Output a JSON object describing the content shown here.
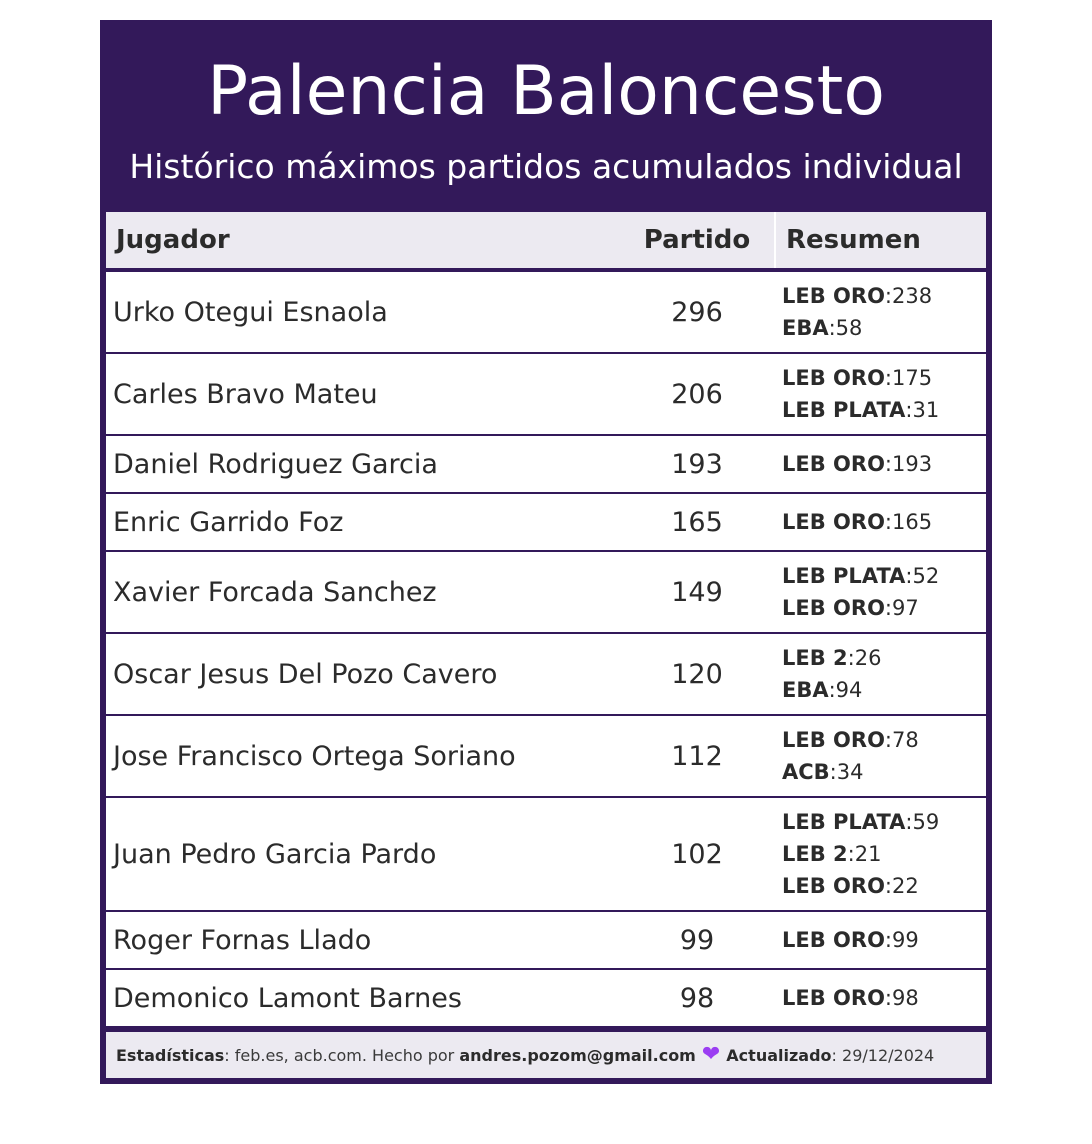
{
  "title": "Palencia Baloncesto",
  "subtitle": "Histórico máximos partidos acumulados individual",
  "columns": {
    "player": "Jugador",
    "games": "Partido",
    "summary": "Resumen"
  },
  "rows": [
    {
      "name": "Urko Otegui Esnaola",
      "games": "296",
      "summary": [
        {
          "league": "LEB ORO",
          "count": ":238"
        },
        {
          "league": "EBA",
          "count": ":58"
        }
      ]
    },
    {
      "name": "Carles Bravo Mateu",
      "games": "206",
      "summary": [
        {
          "league": "LEB ORO",
          "count": ":175"
        },
        {
          "league": "LEB PLATA",
          "count": ":31"
        }
      ]
    },
    {
      "name": "Daniel Rodriguez Garcia",
      "games": "193",
      "summary": [
        {
          "league": "LEB ORO",
          "count": ":193"
        }
      ]
    },
    {
      "name": "Enric Garrido Foz",
      "games": "165",
      "summary": [
        {
          "league": "LEB ORO",
          "count": ":165"
        }
      ]
    },
    {
      "name": "Xavier Forcada Sanchez",
      "games": "149",
      "summary": [
        {
          "league": "LEB PLATA",
          "count": ":52"
        },
        {
          "league": "LEB ORO",
          "count": ":97"
        }
      ]
    },
    {
      "name": "Oscar Jesus Del Pozo Cavero",
      "games": "120",
      "summary": [
        {
          "league": "LEB 2",
          "count": ":26"
        },
        {
          "league": "EBA",
          "count": ":94"
        }
      ]
    },
    {
      "name": "Jose Francisco Ortega Soriano",
      "games": "112",
      "summary": [
        {
          "league": "LEB ORO",
          "count": ":78"
        },
        {
          "league": "ACB",
          "count": ":34"
        }
      ]
    },
    {
      "name": "Juan Pedro Garcia Pardo",
      "games": "102",
      "summary": [
        {
          "league": "LEB PLATA",
          "count": ":59"
        },
        {
          "league": "LEB 2",
          "count": ":21"
        },
        {
          "league": "LEB ORO",
          "count": ":22"
        }
      ]
    },
    {
      "name": "Roger Fornas Llado",
      "games": "99",
      "summary": [
        {
          "league": "LEB ORO",
          "count": ":99"
        }
      ]
    },
    {
      "name": "Demonico Lamont Barnes",
      "games": "98",
      "summary": [
        {
          "league": "LEB ORO",
          "count": ":98"
        }
      ]
    }
  ],
  "footer": {
    "stats_label": "Estadísticas",
    "stats_value": ": feb.es, acb.com. Hecho por ",
    "author": "andres.pozom@gmail.com",
    "heart_icon": "purple-heart-icon",
    "heart_color": "#9b3df2",
    "updated_label": "Actualizado",
    "updated_value": ": 29/12/2024"
  },
  "colors": {
    "frame": "#33195a",
    "header_bg": "#eceaf1",
    "row_bg": "#ffffff"
  }
}
